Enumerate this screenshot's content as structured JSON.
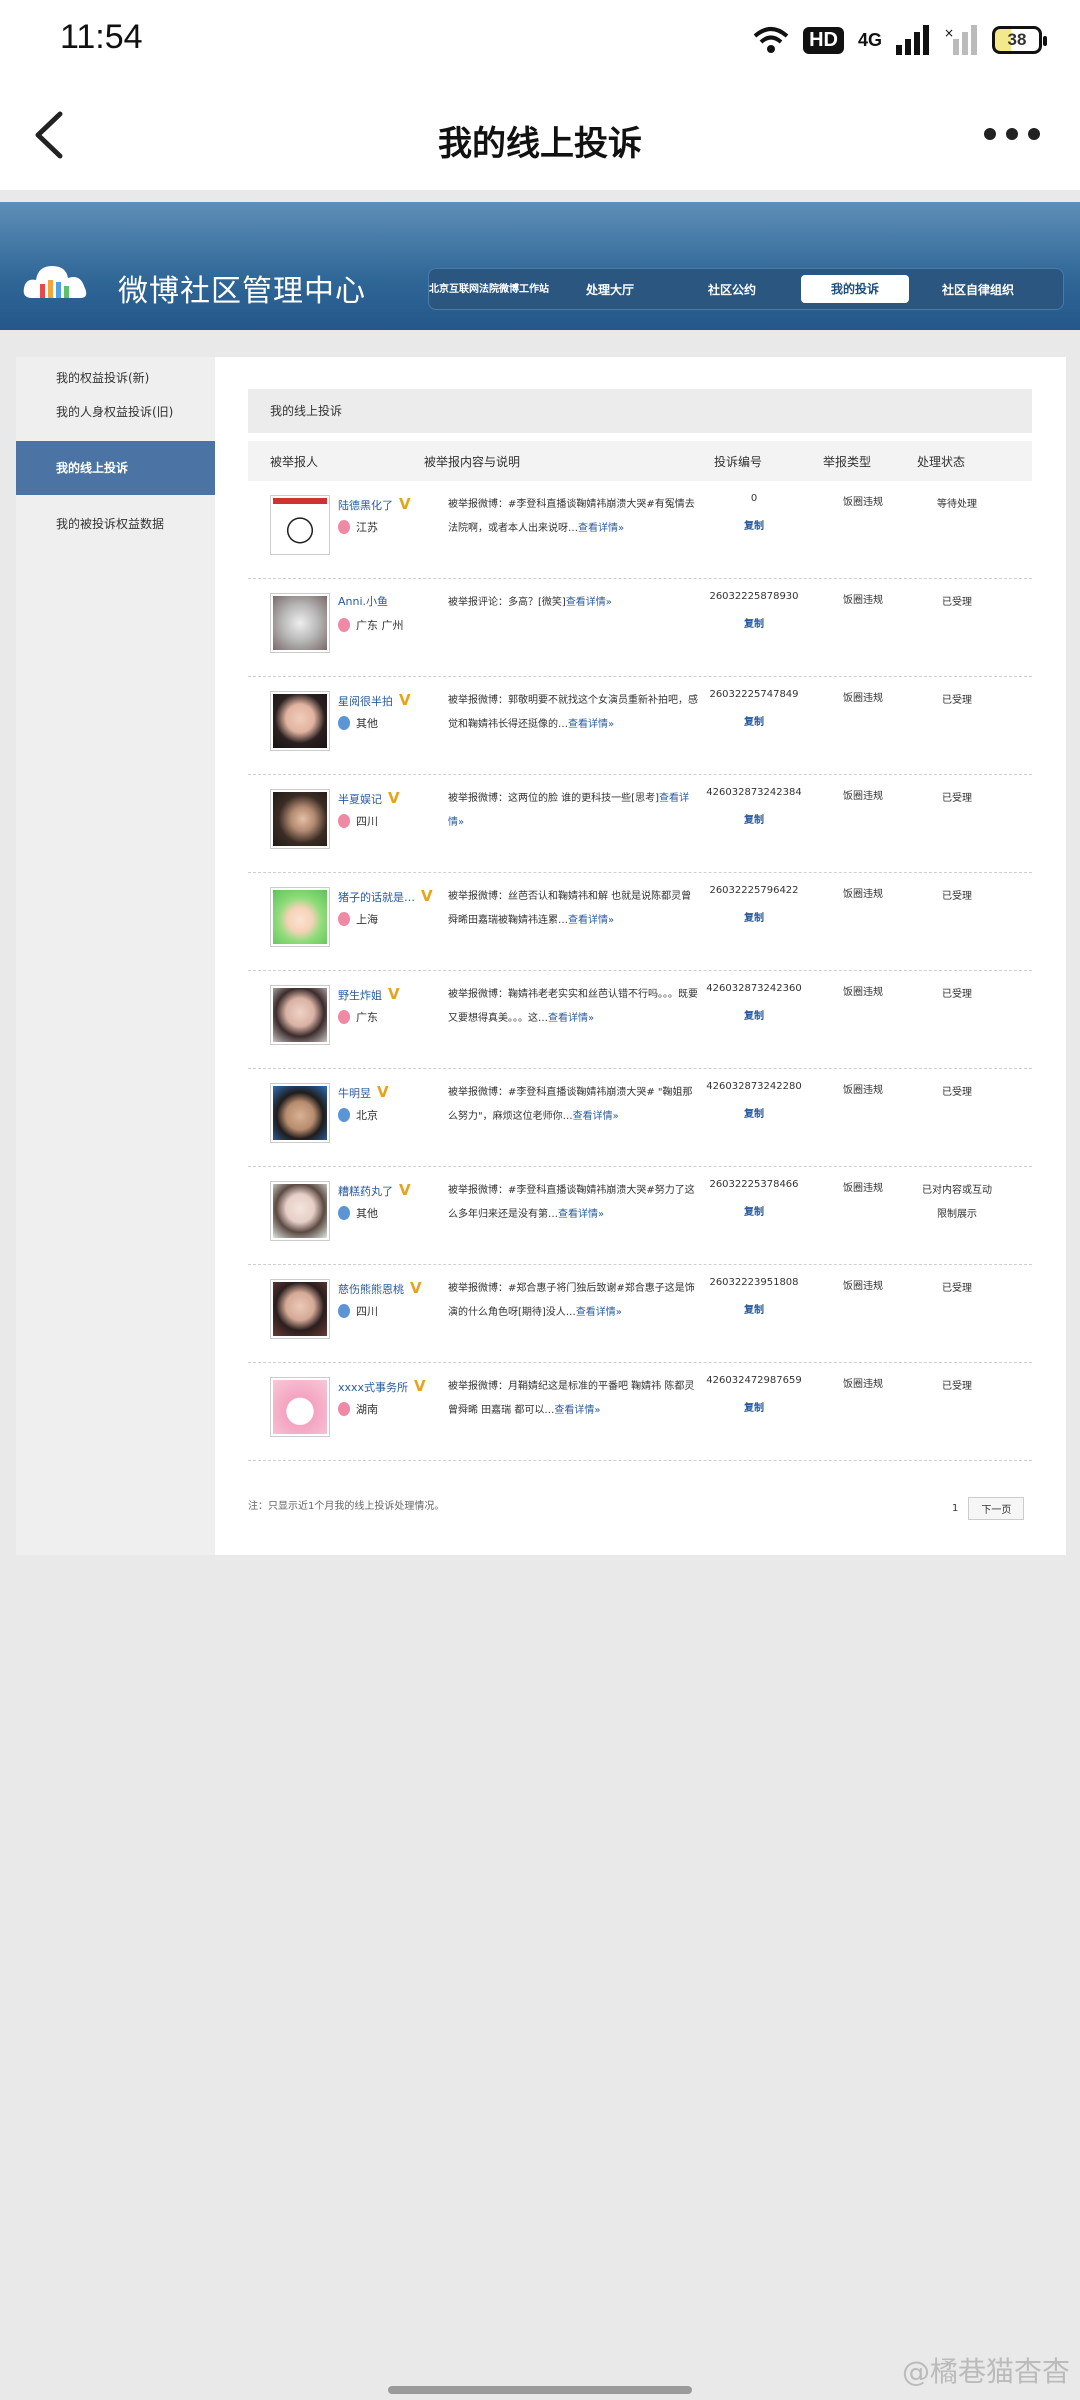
{
  "status_bar": {
    "time": "11:54",
    "hd": "HD",
    "network": "4G",
    "battery": "38"
  },
  "app_bar": {
    "title": "我的线上投诉"
  },
  "banner": {
    "logo_text": "微博社区管理中心",
    "nav": {
      "court": "北京互联网法院微博工作站",
      "hall": "处理大厅",
      "rules": "社区公约",
      "my_complaints": "我的投诉",
      "self_org": "社区自律组织"
    }
  },
  "sidebar": {
    "items": [
      "我的权益投诉(新)",
      "我的人身权益投诉(旧)",
      "我的线上投诉",
      "我的被投诉权益数据"
    ]
  },
  "main": {
    "section_title": "我的线上投诉",
    "columns": {
      "reported": "被举报人",
      "content": "被举报内容与说明",
      "number": "投诉编号",
      "type": "举报类型",
      "status": "处理状态"
    },
    "copy_label": "复制",
    "more_label": "查看详情»",
    "rows": [
      {
        "name": "陆德黑化了",
        "verified": true,
        "gender": "f",
        "location": "江苏",
        "desc": "被举报微博：#李登科直播谈鞠婧祎崩溃大哭#有冤情去法院啊，或者本人出来说呀…",
        "number": "0",
        "type": "饭圈违规",
        "status": "等待处理",
        "avatar": "mask"
      },
      {
        "name": "Anni.小鱼",
        "verified": false,
        "gender": "f",
        "location": "广东 广州",
        "desc": "被举报评论：多高？[微笑]",
        "number": "26032225878930",
        "type": "饭圈违规",
        "status": "已受理",
        "avatar": "cat"
      },
      {
        "name": "星阅很半拍",
        "verified": true,
        "gender": "m",
        "location": "其他",
        "desc": "被举报微博：郭敬明要不就找这个女演员重新补拍吧，感觉和鞠婧祎长得还挺像的…",
        "number": "26032225747849",
        "type": "饭圈违规",
        "status": "已受理",
        "avatar": "girl1"
      },
      {
        "name": "半夏娱记",
        "verified": true,
        "gender": "f",
        "location": "四川",
        "desc": "被举报微博：这两位的脸 谁的更科技一些[思考]",
        "number": "426032873242384",
        "type": "饭圈违规",
        "status": "已受理",
        "avatar": "girl2"
      },
      {
        "name": "猪子的话就是…",
        "verified": true,
        "gender": "f",
        "location": "上海",
        "desc": "被举报微博：丝芭否认和鞠婧祎和解 也就是说陈都灵曾舜晞田嘉瑞被鞠婧祎连累…",
        "number": "26032225796422",
        "type": "饭圈违规",
        "status": "已受理",
        "avatar": "anime"
      },
      {
        "name": "野生炸姐",
        "verified": true,
        "gender": "f",
        "location": "广东",
        "desc": "被举报微博：鞠婧祎老老实实和丝芭认错不行吗。。。既要又要想得真美。。。这…",
        "number": "426032873242360",
        "type": "饭圈违规",
        "status": "已受理",
        "avatar": "girl3"
      },
      {
        "name": "牛明昱",
        "verified": true,
        "gender": "m",
        "location": "北京",
        "desc": "被举报微博：#李登科直播谈鞠婧祎崩溃大哭# \"鞠姐那么努力\"，麻烦这位老师你…",
        "number": "426032873242280",
        "type": "饭圈违规",
        "status": "已受理",
        "avatar": "boy"
      },
      {
        "name": "糟糕药丸了",
        "verified": true,
        "gender": "m",
        "location": "其他",
        "desc": "被举报微博：#李登科直播谈鞠婧祎崩溃大哭#努力了这么多年归来还是没有第…",
        "number": "26032225378466",
        "type": "饭圈违规",
        "status": "已对内容或互动限制展示",
        "avatar": "girl4"
      },
      {
        "name": "慈伤熊熊恩桃",
        "verified": true,
        "gender": "m",
        "location": "四川",
        "desc": "被举报微博：#郑合惠子将门独后致谢#郑合惠子这是饰演的什么角色呀[期待]没人…",
        "number": "26032223951808",
        "type": "饭圈违规",
        "status": "已受理",
        "avatar": "girl5"
      },
      {
        "name": "xxxx式事务所",
        "verified": true,
        "gender": "f",
        "location": "湖南",
        "desc": "被举报微博：月鞘婧纪这是标准的平番吧 鞠婧祎 陈都灵 曾舜晞 田嘉瑞 都可以…",
        "number": "426032472987659",
        "type": "饭圈违规",
        "status": "已受理",
        "avatar": "melody"
      }
    ]
  },
  "footer": {
    "note": "注：只显示近1个月我的线上投诉处理情况。",
    "page": "1",
    "next": "下一页"
  },
  "watermark": "@橘巷猫杳杳"
}
